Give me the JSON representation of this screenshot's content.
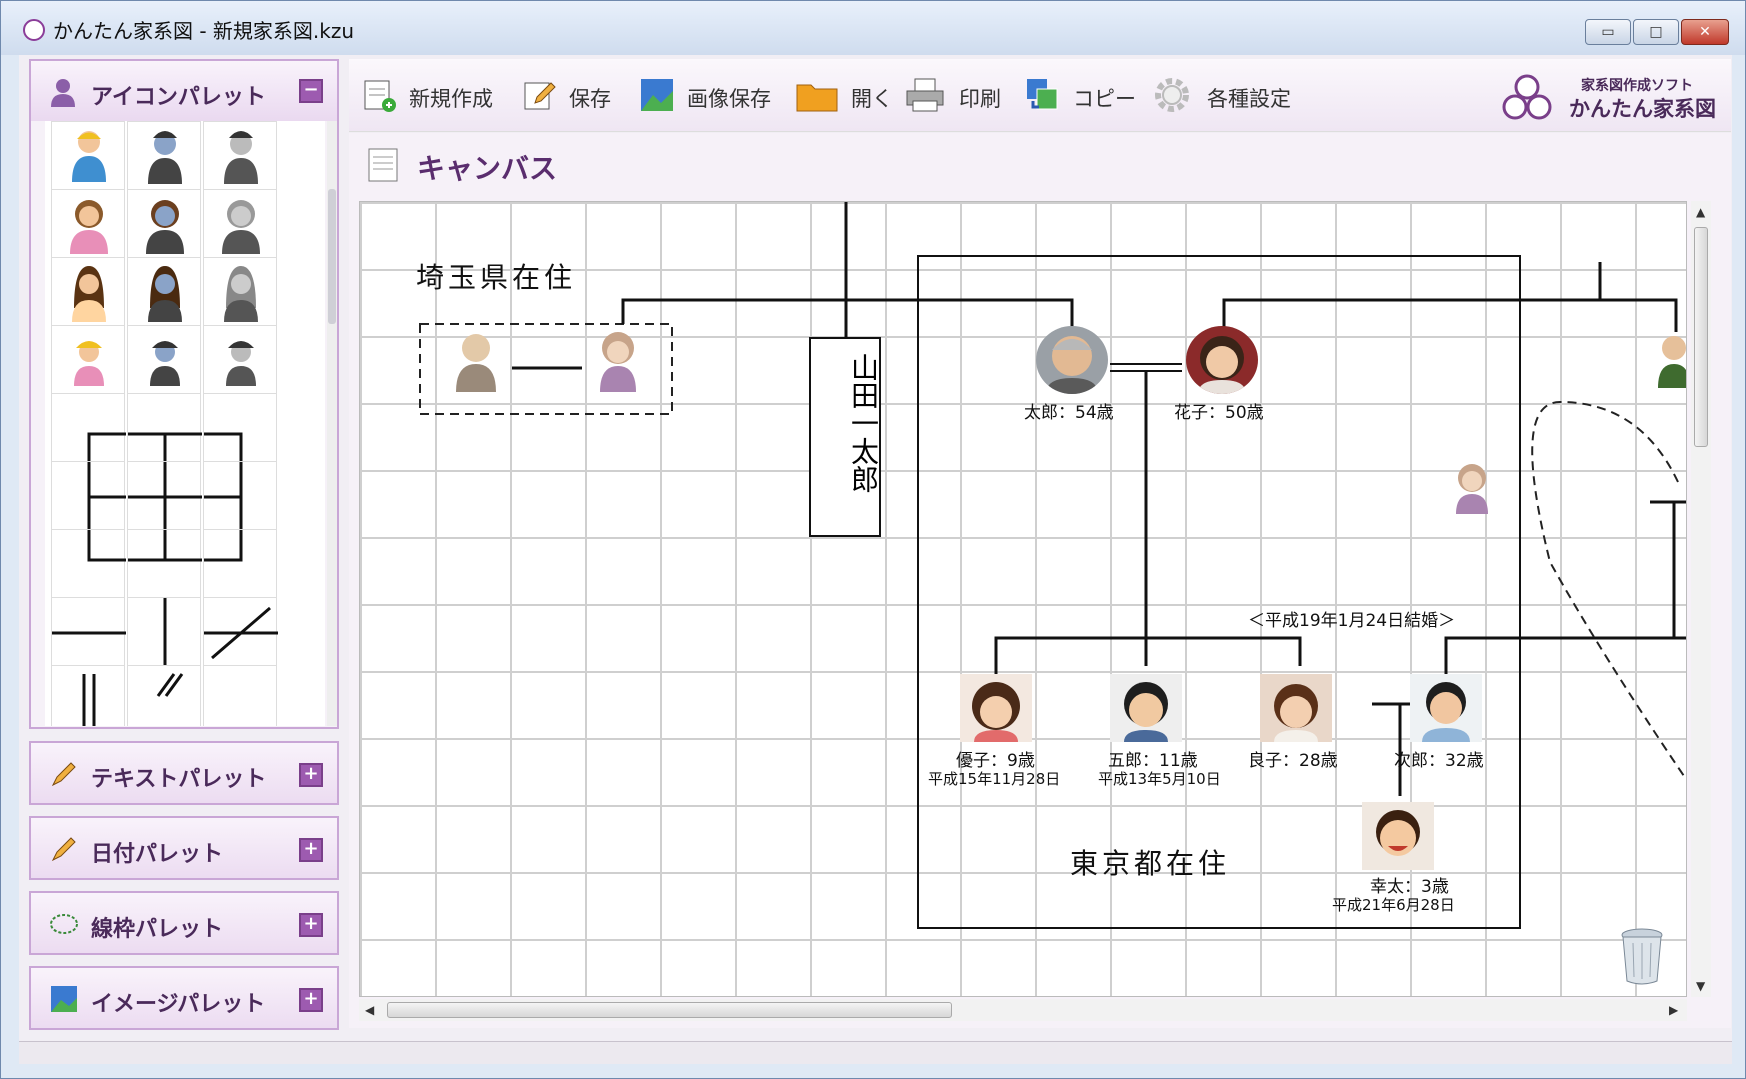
{
  "window": {
    "title": "かんたん家系図 - 新規家系図.kzu",
    "min": "▭",
    "max": "□",
    "close": "✕"
  },
  "palettes": {
    "icon_palette": {
      "title": "アイコンパレット",
      "toggle": "−"
    },
    "text_palette": {
      "title": "テキストパレット",
      "toggle": "+"
    },
    "date_palette": {
      "title": "日付パレット",
      "toggle": "+"
    },
    "frame_palette": {
      "title": "線枠パレット",
      "toggle": "+"
    },
    "image_palette": {
      "title": "イメージパレット",
      "toggle": "+"
    }
  },
  "toolbar": {
    "new": "新規作成",
    "save": "保存",
    "save_image": "画像保存",
    "open": "開く",
    "print": "印刷",
    "copy": "コピー",
    "settings": "各種設定"
  },
  "logo": {
    "small": "家系図作成ソフト",
    "big": "かんたん家系図"
  },
  "canvas": {
    "title": "キャンバス",
    "region_saitama": "埼玉県在住",
    "region_tokyo": "東京都在住",
    "vertical_name": "山田一太郎",
    "marriage_note": "＜平成19年1月24日結婚＞",
    "people": {
      "taro": {
        "label": "太郎：54歳"
      },
      "hanako": {
        "label": "花子：50歳"
      },
      "yuko": {
        "label": "優子：9歳",
        "date": "平成15年11月28日"
      },
      "goro": {
        "label": "五郎：11歳",
        "date": "平成13年5月10日"
      },
      "ryoko": {
        "label": "良子：28歳"
      },
      "jiro": {
        "label": "次郎：32歳"
      },
      "kota": {
        "label": "幸太：3歳",
        "date": "平成21年6月28日"
      }
    }
  },
  "colors": {
    "accent": "#9d5bb0",
    "palette_border": "#c9a6d6",
    "title_text": "#5a2d6e"
  }
}
